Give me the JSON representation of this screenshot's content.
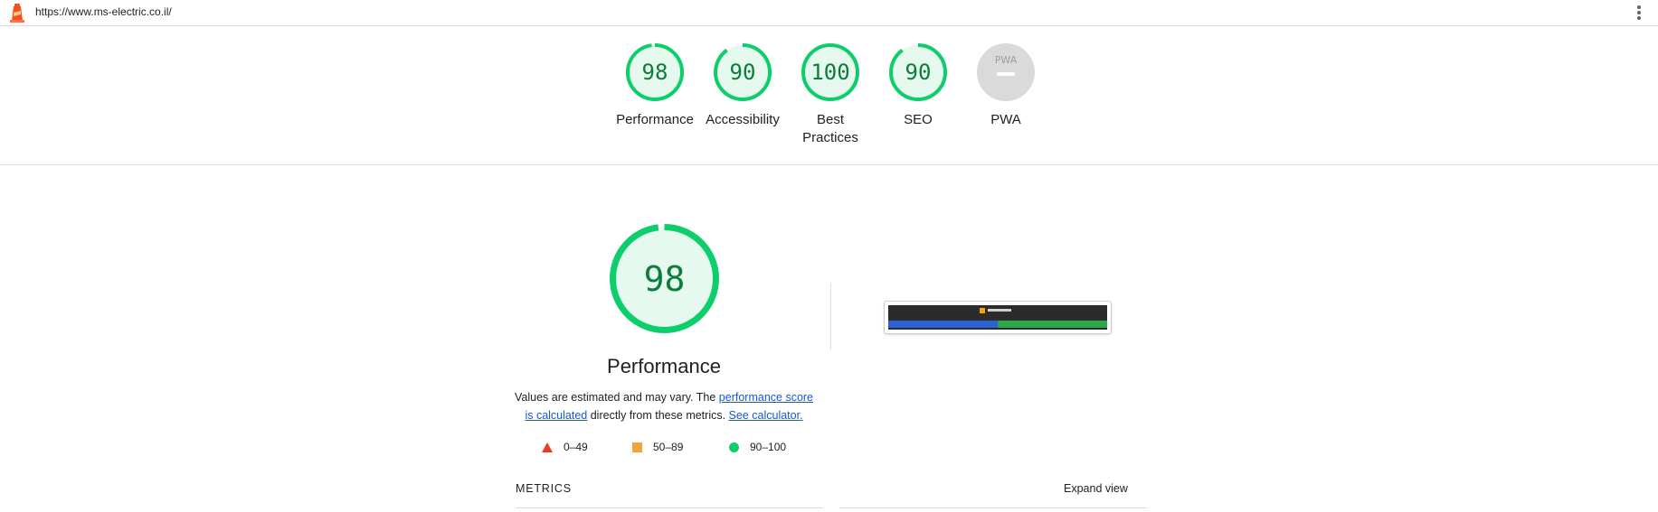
{
  "url_bar": {
    "url": "https://www.ms-electric.co.il/"
  },
  "categories": [
    {
      "label": "Performance",
      "score": "98",
      "fraction": 0.98
    },
    {
      "label": "Accessibility",
      "score": "90",
      "fraction": 0.9
    },
    {
      "label": "Best Practices",
      "score": "100",
      "fraction": 1.0
    },
    {
      "label": "SEO",
      "score": "90",
      "fraction": 0.9
    },
    {
      "label": "PWA",
      "score": "",
      "badge": "PWA"
    }
  ],
  "performance": {
    "score": "98",
    "fraction": 0.98,
    "title": "Performance",
    "desc_prefix": "Values are estimated and may vary. The ",
    "desc_link": "performance score is calculated",
    "desc_middle": " directly from these metrics. ",
    "desc_calc": "See calculator."
  },
  "legend": [
    {
      "range": "0–49",
      "shape": "triangle",
      "color": "#eb3a2c"
    },
    {
      "range": "50–89",
      "shape": "square",
      "color": "#f0a23b"
    },
    {
      "range": "90–100",
      "shape": "circle",
      "color": "#0cce6b"
    }
  ],
  "metrics": {
    "heading": "METRICS",
    "expand_label": "Expand view"
  },
  "colors": {
    "pass": "#0cce6b",
    "pass_bg": "#e6f9ee",
    "pass_text": "#0b7d3a",
    "pwa_gray": "#dadada"
  }
}
